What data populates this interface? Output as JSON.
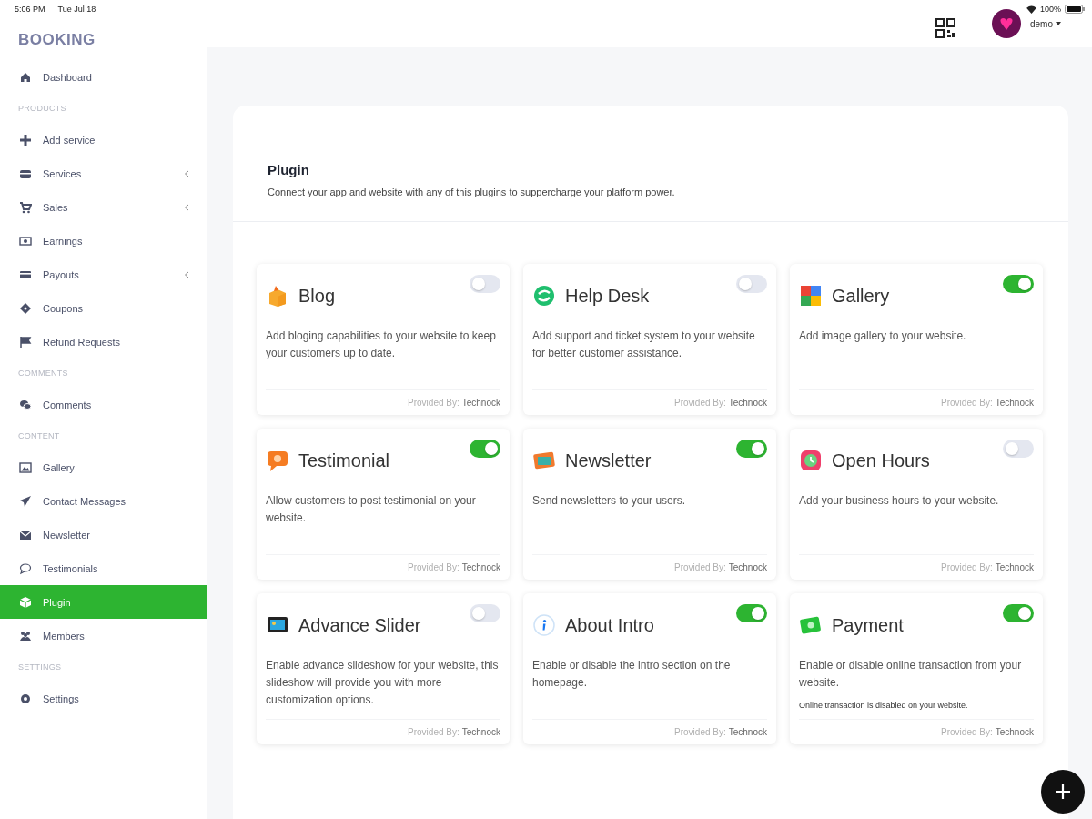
{
  "status_bar": {
    "time": "5:06 PM",
    "date": "Tue Jul 18",
    "battery": "100%"
  },
  "sidebar": {
    "brand": "BOOKING",
    "items": [
      {
        "kind": "item",
        "label": "Dashboard",
        "expandable": false,
        "selected": false
      },
      {
        "kind": "section",
        "label": "PRODUCTS"
      },
      {
        "kind": "item",
        "label": "Add service",
        "expandable": false,
        "selected": false
      },
      {
        "kind": "item",
        "label": "Services",
        "expandable": true,
        "selected": false
      },
      {
        "kind": "item",
        "label": "Sales",
        "expandable": true,
        "selected": false
      },
      {
        "kind": "item",
        "label": "Earnings",
        "expandable": false,
        "selected": false
      },
      {
        "kind": "item",
        "label": "Payouts",
        "expandable": true,
        "selected": false
      },
      {
        "kind": "item",
        "label": "Coupons",
        "expandable": false,
        "selected": false
      },
      {
        "kind": "item",
        "label": "Refund Requests",
        "expandable": false,
        "selected": false
      },
      {
        "kind": "section",
        "label": "COMMENTS"
      },
      {
        "kind": "item",
        "label": "Comments",
        "expandable": false,
        "selected": false
      },
      {
        "kind": "section",
        "label": "CONTENT"
      },
      {
        "kind": "item",
        "label": "Gallery",
        "expandable": false,
        "selected": false
      },
      {
        "kind": "item",
        "label": "Contact Messages",
        "expandable": false,
        "selected": false
      },
      {
        "kind": "item",
        "label": "Newsletter",
        "expandable": false,
        "selected": false
      },
      {
        "kind": "item",
        "label": "Testimonials",
        "expandable": false,
        "selected": false
      },
      {
        "kind": "item",
        "label": "Plugin",
        "expandable": false,
        "selected": true
      },
      {
        "kind": "item",
        "label": "Members",
        "expandable": false,
        "selected": false
      },
      {
        "kind": "section",
        "label": "SETTINGS"
      },
      {
        "kind": "item",
        "label": "Settings",
        "expandable": false,
        "selected": false
      }
    ]
  },
  "header": {
    "user": "demo"
  },
  "page": {
    "title": "Plugin",
    "description": "Connect your app and website with any of this plugins to suppercharge your platform power."
  },
  "plugins": [
    {
      "name": "Blog",
      "on": false,
      "description": "Add bloging capabilities to your website to keep your customers up to date.",
      "provider_label": "Provided By:",
      "provider": "Technock"
    },
    {
      "name": "Help Desk",
      "on": false,
      "description": "Add support and ticket system to your website for better customer assistance.",
      "provider_label": "Provided By:",
      "provider": "Technock"
    },
    {
      "name": "Gallery",
      "on": true,
      "description": "Add image gallery to your website.",
      "provider_label": "Provided By:",
      "provider": "Technock"
    },
    {
      "name": "Testimonial",
      "on": true,
      "description": "Allow customers to post testimonial on your website.",
      "provider_label": "Provided By:",
      "provider": "Technock"
    },
    {
      "name": "Newsletter",
      "on": true,
      "description": "Send newsletters to your users.",
      "provider_label": "Provided By:",
      "provider": "Technock"
    },
    {
      "name": "Open Hours",
      "on": false,
      "description": "Add your business hours to your website.",
      "provider_label": "Provided By:",
      "provider": "Technock"
    },
    {
      "name": "Advance Slider",
      "on": false,
      "description": "Enable advance slideshow for your website, this slideshow will provide you with more customization options.",
      "provider_label": "Provided By:",
      "provider": "Technock"
    },
    {
      "name": "About Intro",
      "on": true,
      "description": "Enable or disable the intro section on the homepage.",
      "provider_label": "Provided By:",
      "provider": "Technock"
    },
    {
      "name": "Payment",
      "on": true,
      "description": "Enable or disable online transaction from your website.",
      "note": "Online transaction is disabled on your website.",
      "provider_label": "Provided By:",
      "provider": "Technock"
    }
  ]
}
